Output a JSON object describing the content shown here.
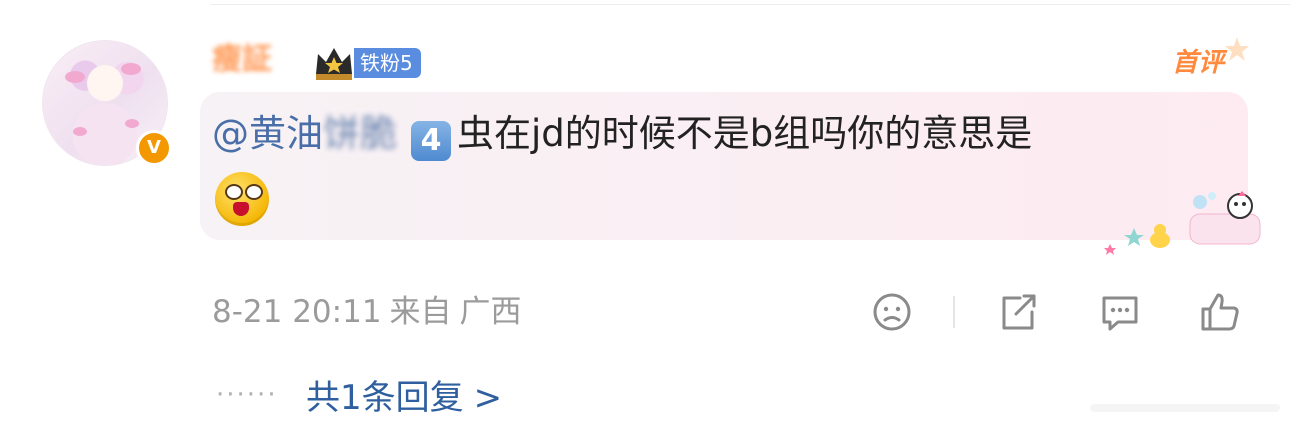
{
  "comment": {
    "username": "瘦証",
    "fan_badge": "铁粉5",
    "first_label": "首评",
    "mention_prefix": "@黄油",
    "mention_blur": "饼脆",
    "number_badge": "4",
    "content": "虫在jd的时候不是b组吗你的意思是",
    "verified_badge": "V",
    "timestamp": "8-21 20:11",
    "source_prefix": "来自",
    "location": "广西",
    "reply_dots": "······",
    "replies_label": "共1条回复",
    "replies_chevron": ">"
  },
  "icons": {
    "avatar": "anime-girl-avatar",
    "verified": "verified-v-icon",
    "crown": "crown-icon",
    "emoji": "drooling-face-emoji",
    "dislike": "sad-face-icon",
    "share": "share-icon",
    "comment": "comment-icon",
    "like": "thumbs-up-icon"
  },
  "colors": {
    "accent_orange": "#ff8a3d",
    "link_blue": "#2f5f9e",
    "badge_blue": "#5a8ddf",
    "meta_gray": "#9b9b9b"
  }
}
